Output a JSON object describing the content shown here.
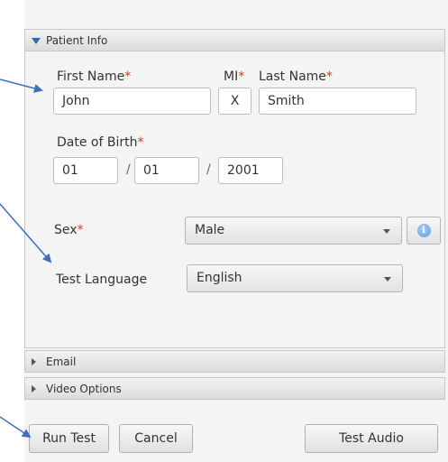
{
  "sections": {
    "patient_info": "Patient Info",
    "email": "Email",
    "video_options": "Video Options"
  },
  "patient": {
    "first_name_label": "First Name",
    "mi_label": "MI",
    "last_name_label": "Last Name",
    "required_mark": "*",
    "first_name": "John",
    "mi": "X",
    "last_name": "Smith",
    "dob_label": "Date of Birth",
    "dob_month": "01",
    "dob_day": "01",
    "dob_year": "2001",
    "dob_separator": "/",
    "sex_label": "Sex",
    "sex_value": "Male",
    "test_language_label": "Test Language",
    "test_language_value": "English",
    "info_symbol": "i"
  },
  "actions": {
    "run_test": "Run Test",
    "cancel": "Cancel",
    "test_audio": "Test Audio"
  },
  "colors": {
    "required": "#dd3333",
    "accent": "#2a6fb3",
    "annotation_arrow": "#3f6fbd"
  },
  "icons": [
    "expanded-triangle-icon",
    "collapsed-triangle-icon",
    "info-icon",
    "dropdown-caret-icon"
  ]
}
